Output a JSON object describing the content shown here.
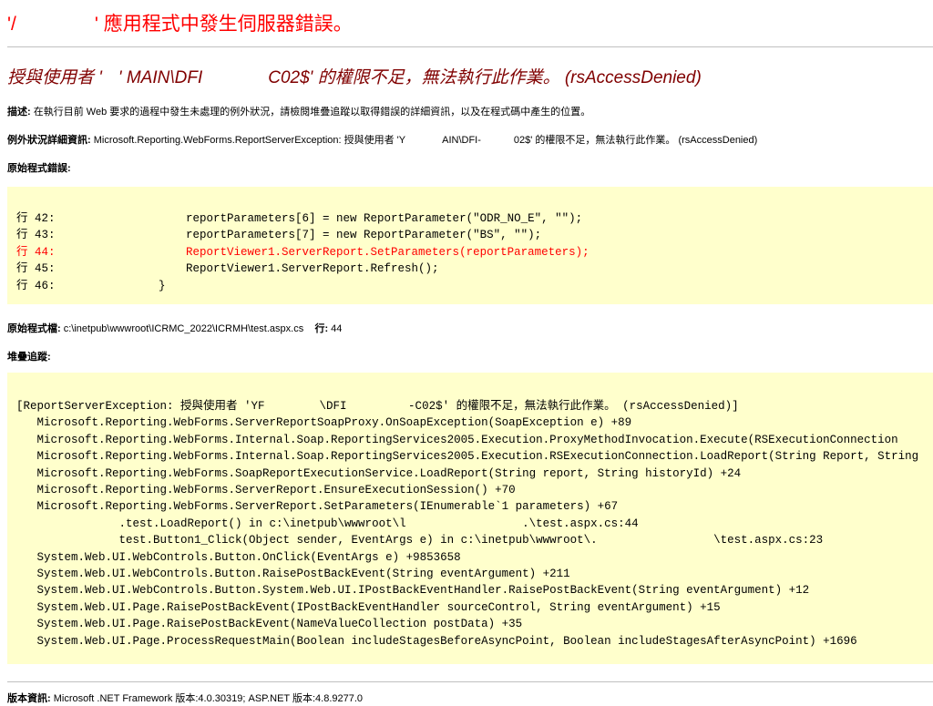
{
  "page": {
    "title_prefix": "'/",
    "title_mid": "'",
    "title_rest": "應用程式中發生伺服器錯誤。",
    "subtitle_a": "授與使用者 '",
    "subtitle_b": "'",
    "subtitle_c": "MAIN\\DFI",
    "subtitle_d": "C02$' 的權限不足，無法執行此作業。 (rsAccessDenied)"
  },
  "description": {
    "label": "描述:",
    "text": " 在執行目前 Web 要求的過程中發生未處理的例外狀況，請檢閱堆疊追蹤以取得錯誤的詳細資訊，以及在程式碼中產生的位置。"
  },
  "exception": {
    "label": "例外狀況詳細資訊:",
    "text_a": " Microsoft.Reporting.WebForms.ReportServerException: 授與使用者 'Y",
    "text_b": "AIN\\DFI-",
    "text_c": "02$' 的權限不足，無法執行此作業。 (rsAccessDenied)"
  },
  "source_error": {
    "label": "原始程式錯誤:",
    "lines": [
      {
        "no": "行 42:",
        "code": "            reportParameters[6] = new ReportParameter(\"ODR_NO_E\", \"\");"
      },
      {
        "no": "行 43:",
        "code": "            reportParameters[7] = new ReportParameter(\"BS\", \"\");"
      },
      {
        "no": "行 44:",
        "code": "            ReportViewer1.ServerReport.SetParameters(reportParameters);"
      },
      {
        "no": "行 45:",
        "code": "            ReportViewer1.ServerReport.Refresh();"
      },
      {
        "no": "行 46:",
        "code": "        }"
      }
    ]
  },
  "source_file": {
    "label": "原始程式檔:",
    "path": " c:\\inetpub\\wwwroot\\ICRMC_2022\\ICRMH\\test.aspx.cs",
    "line_label": "行:",
    "line_no": " 44"
  },
  "stack_trace": {
    "label": "堆疊追蹤:",
    "lines": [
      "[ReportServerException: 授與使用者 'YF        \\DFI         -C02$' 的權限不足，無法執行此作業。 (rsAccessDenied)]",
      "   Microsoft.Reporting.WebForms.ServerReportSoapProxy.OnSoapException(SoapException e) +89",
      "   Microsoft.Reporting.WebForms.Internal.Soap.ReportingServices2005.Execution.ProxyMethodInvocation.Execute(RSExecutionConnection",
      "   Microsoft.Reporting.WebForms.Internal.Soap.ReportingServices2005.Execution.RSExecutionConnection.LoadReport(String Report, String",
      "   Microsoft.Reporting.WebForms.SoapReportExecutionService.LoadReport(String report, String historyId) +24",
      "   Microsoft.Reporting.WebForms.ServerReport.EnsureExecutionSession() +70",
      "   Microsoft.Reporting.WebForms.ServerReport.SetParameters(IEnumerable`1 parameters) +67",
      "               .test.LoadReport() in c:\\inetpub\\wwwroot\\l                 .\\test.aspx.cs:44",
      "               test.Button1_Click(Object sender, EventArgs e) in c:\\inetpub\\wwwroot\\.                 \\test.aspx.cs:23",
      "   System.Web.UI.WebControls.Button.OnClick(EventArgs e) +9853658",
      "   System.Web.UI.WebControls.Button.RaisePostBackEvent(String eventArgument) +211",
      "   System.Web.UI.WebControls.Button.System.Web.UI.IPostBackEventHandler.RaisePostBackEvent(String eventArgument) +12",
      "   System.Web.UI.Page.RaisePostBackEvent(IPostBackEventHandler sourceControl, String eventArgument) +15",
      "   System.Web.UI.Page.RaisePostBackEvent(NameValueCollection postData) +35",
      "   System.Web.UI.Page.ProcessRequestMain(Boolean includeStagesBeforeAsyncPoint, Boolean includeStagesAfterAsyncPoint) +1696"
    ]
  },
  "version": {
    "label": "版本資訊:",
    "text": " Microsoft .NET Framework 版本:4.0.30319; ASP.NET 版本:4.8.9277.0"
  },
  "colors": {
    "title": "#ff0000",
    "subtitle": "#800000",
    "code_background": "#ffffcc",
    "error_line": "#ff0000"
  }
}
